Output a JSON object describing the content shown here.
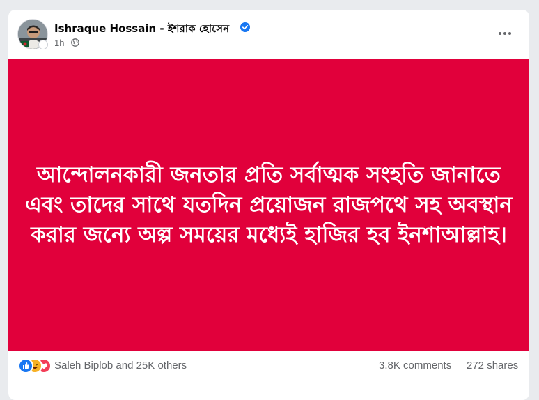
{
  "post": {
    "author": "Ishraque Hossain - ইশরাক হোসেন",
    "time": "1h",
    "image_text": "আন্দোলনকারী জনতার প্রতি সর্বাত্মক সংহতি জানাতে এবং তাদের সাথে যতদিন প্রয়োজন রাজপথে সহ অবস্থান করার জন্যে অল্প সময়ের মধ্যেই হাজির হব ইনশাআল্লাহ।",
    "image_background": "#e1003b",
    "icons": {
      "privacy": "globe-icon",
      "verified": "verified-badge-icon",
      "menu": "more-options-icon"
    }
  },
  "engagement": {
    "reactions_summary": "Saleh Biplob and 25K others",
    "comments": "3.8K comments",
    "shares": "272 shares",
    "reaction_types": [
      "like",
      "haha",
      "love"
    ]
  },
  "colors": {
    "text_primary": "#050505",
    "text_secondary": "#65676b",
    "accent_blue": "#1877f2"
  }
}
